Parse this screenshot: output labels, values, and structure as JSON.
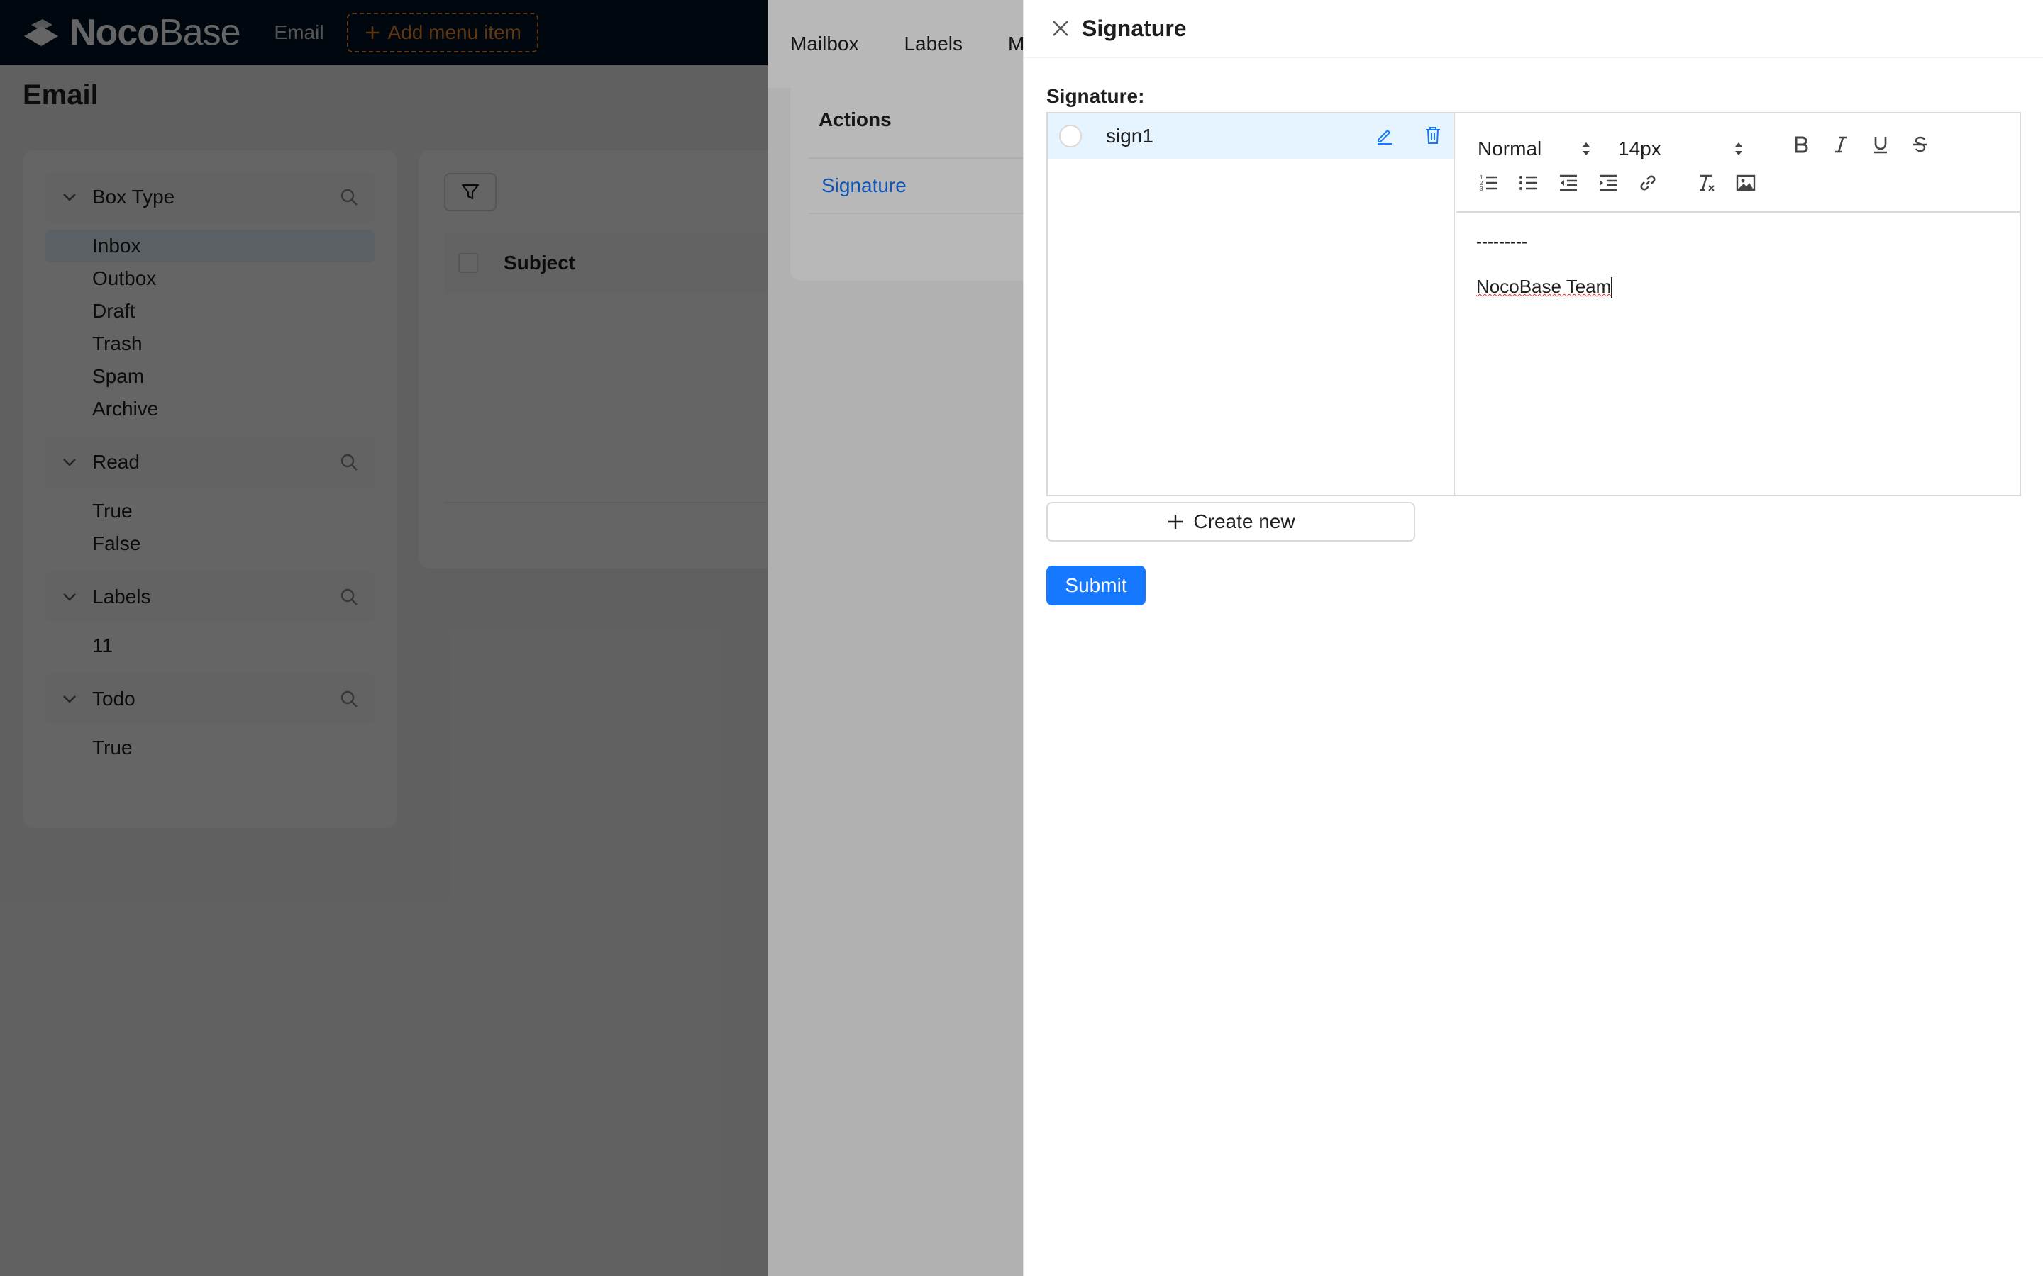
{
  "app": {
    "logo_bold": "Noco",
    "logo_thin": "Base",
    "top_menu": {
      "email": "Email",
      "add_menu_item": "Add menu item"
    },
    "page_title": "Email"
  },
  "filters": {
    "groups": [
      {
        "title": "Box Type",
        "items": [
          "Inbox",
          "Outbox",
          "Draft",
          "Trash",
          "Spam",
          "Archive"
        ],
        "selected": "Inbox"
      },
      {
        "title": "Read",
        "items": [
          "True",
          "False"
        ]
      },
      {
        "title": "Labels",
        "items": [
          "11"
        ]
      },
      {
        "title": "Todo",
        "items": [
          "True"
        ]
      }
    ]
  },
  "table": {
    "column_subject": "Subject"
  },
  "settings_drawer": {
    "tabs": [
      "Mailbox",
      "Labels",
      "M"
    ],
    "actions_header": "Actions",
    "actions_row": "Signature"
  },
  "signature_drawer": {
    "title": "Signature",
    "field_label": "Signature",
    "signatures": [
      {
        "name": "sign1"
      }
    ],
    "editor": {
      "header_select": "Normal",
      "size_select": "14px",
      "content_line1": "---------",
      "content_line2": "NocoBase Team"
    },
    "create_new": "Create new",
    "submit": "Submit"
  },
  "colors": {
    "primary": "#1677ff",
    "accent_orange": "#f18b2b",
    "header_bg": "#001529",
    "selected_bg": "#e6f4ff"
  }
}
